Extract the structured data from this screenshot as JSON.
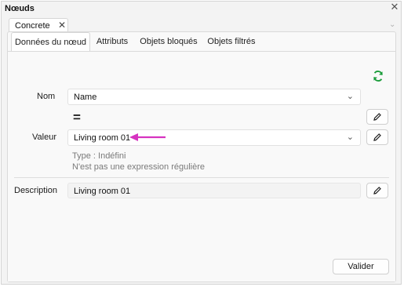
{
  "window": {
    "title": "Nœuds"
  },
  "doc_tab": {
    "label": "Concrete"
  },
  "tabs": [
    {
      "label": "Données du nœud",
      "active": true
    },
    {
      "label": "Attributs",
      "active": false
    },
    {
      "label": "Objets bloqués",
      "active": false
    },
    {
      "label": "Objets filtrés",
      "active": false
    }
  ],
  "form": {
    "name_label": "Nom",
    "name_value": "Name",
    "equals": "=",
    "value_label": "Valeur",
    "value_value": "Living room 01",
    "type_text": "Type : Indéfini",
    "regex_text": "N'est pas une expression régulière",
    "description_label": "Description",
    "description_value": "Living room 01"
  },
  "buttons": {
    "validate_label": "Valider"
  },
  "colors": {
    "refresh_icon": "#1a9c3a",
    "annotation_arrow": "#d633c0"
  }
}
